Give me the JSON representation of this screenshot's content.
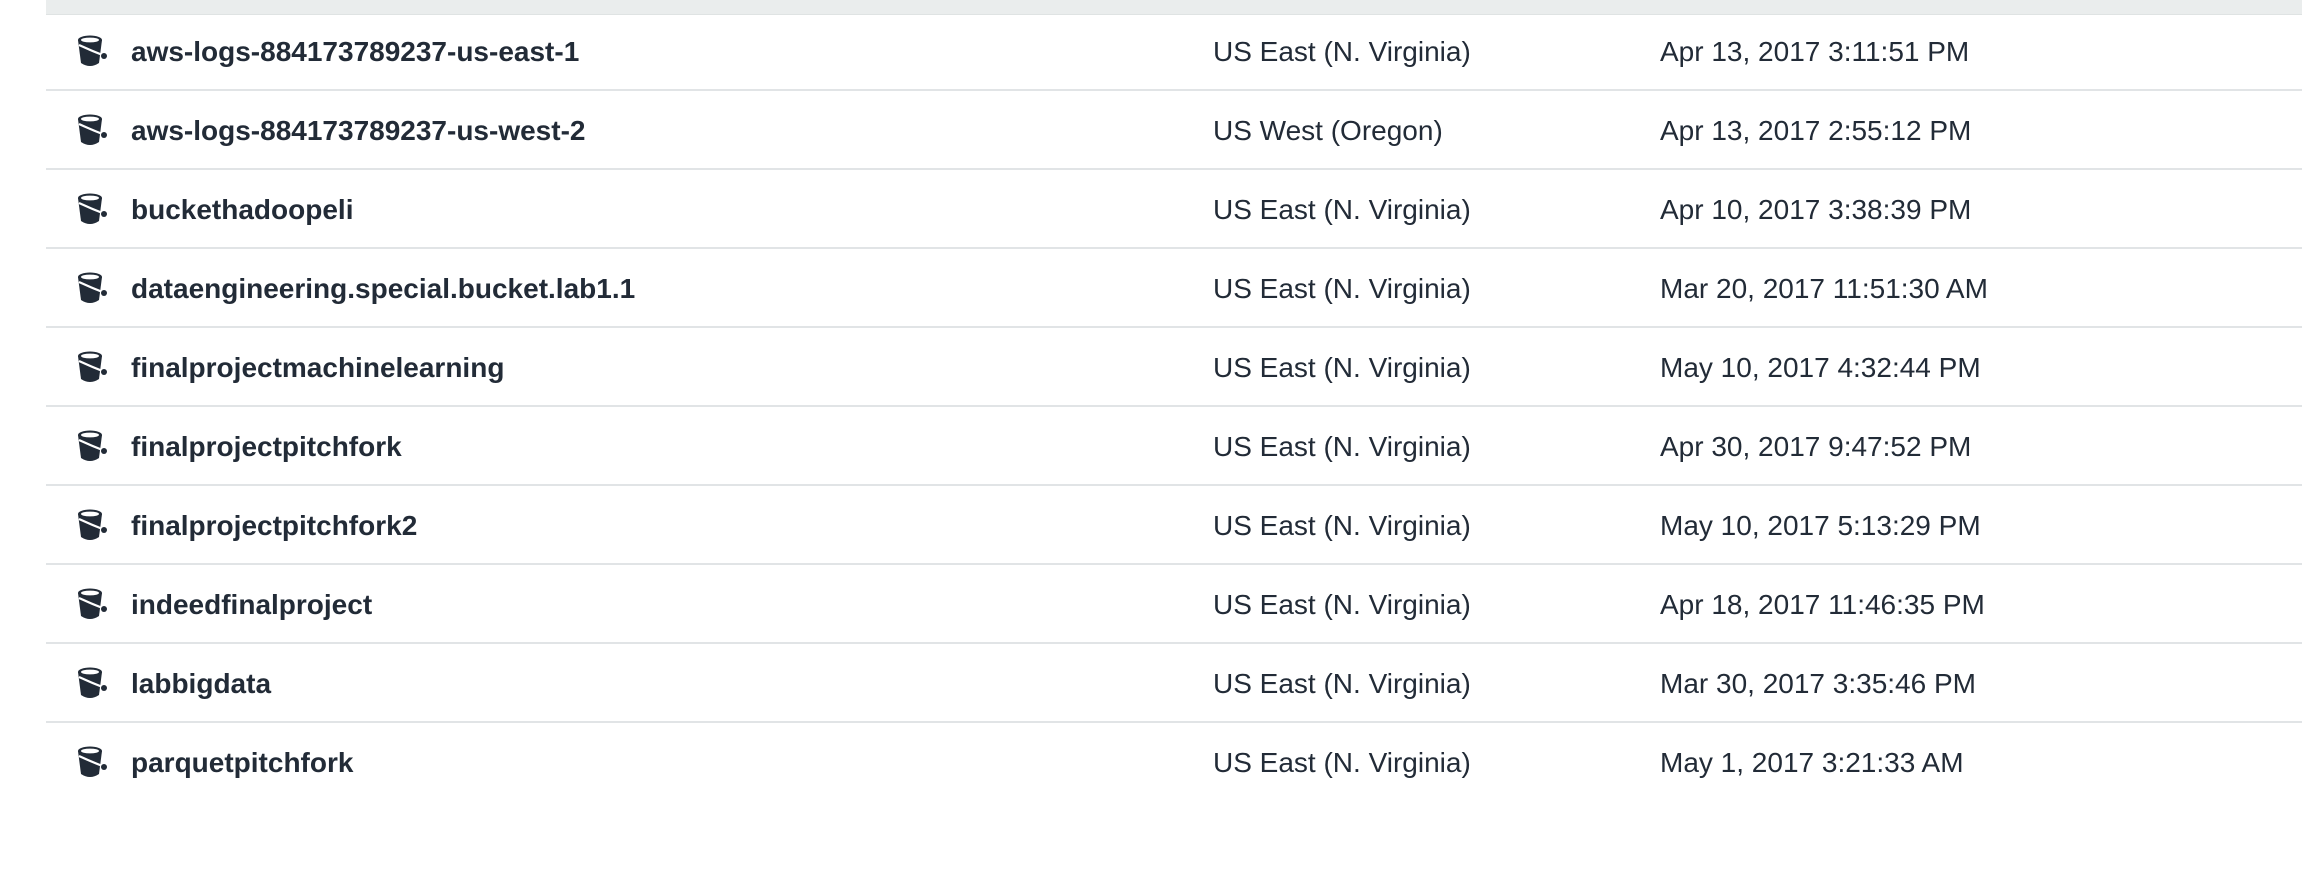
{
  "buckets": [
    {
      "name": "aws-logs-884173789237-us-east-1",
      "region": "US East (N. Virginia)",
      "date_created": "Apr 13, 2017 3:11:51 PM",
      "icon": "bucket-icon"
    },
    {
      "name": "aws-logs-884173789237-us-west-2",
      "region": "US West (Oregon)",
      "date_created": "Apr 13, 2017 2:55:12 PM",
      "icon": "bucket-icon"
    },
    {
      "name": "buckethadoopeli",
      "region": "US East (N. Virginia)",
      "date_created": "Apr 10, 2017 3:38:39 PM",
      "icon": "bucket-icon"
    },
    {
      "name": "dataengineering.special.bucket.lab1.1",
      "region": "US East (N. Virginia)",
      "date_created": "Mar 20, 2017 11:51:30 AM",
      "icon": "bucket-icon"
    },
    {
      "name": "finalprojectmachinelearning",
      "region": "US East (N. Virginia)",
      "date_created": "May 10, 2017 4:32:44 PM",
      "icon": "bucket-icon"
    },
    {
      "name": "finalprojectpitchfork",
      "region": "US East (N. Virginia)",
      "date_created": "Apr 30, 2017 9:47:52 PM",
      "icon": "bucket-icon"
    },
    {
      "name": "finalprojectpitchfork2",
      "region": "US East (N. Virginia)",
      "date_created": "May 10, 2017 5:13:29 PM",
      "icon": "bucket-icon"
    },
    {
      "name": "indeedfinalproject",
      "region": "US East (N. Virginia)",
      "date_created": "Apr 18, 2017 11:46:35 PM",
      "icon": "bucket-icon"
    },
    {
      "name": "labbigdata",
      "region": "US East (N. Virginia)",
      "date_created": "Mar 30, 2017 3:35:46 PM",
      "icon": "bucket-icon"
    },
    {
      "name": "parquetpitchfork",
      "region": "US East (N. Virginia)",
      "date_created": "May 1, 2017 3:21:33 AM",
      "icon": "bucket-icon"
    }
  ],
  "colors": {
    "text": "#222b37",
    "row_divider": "#e1e4e6",
    "header_band": "#eaeded",
    "icon": "#222b37"
  }
}
